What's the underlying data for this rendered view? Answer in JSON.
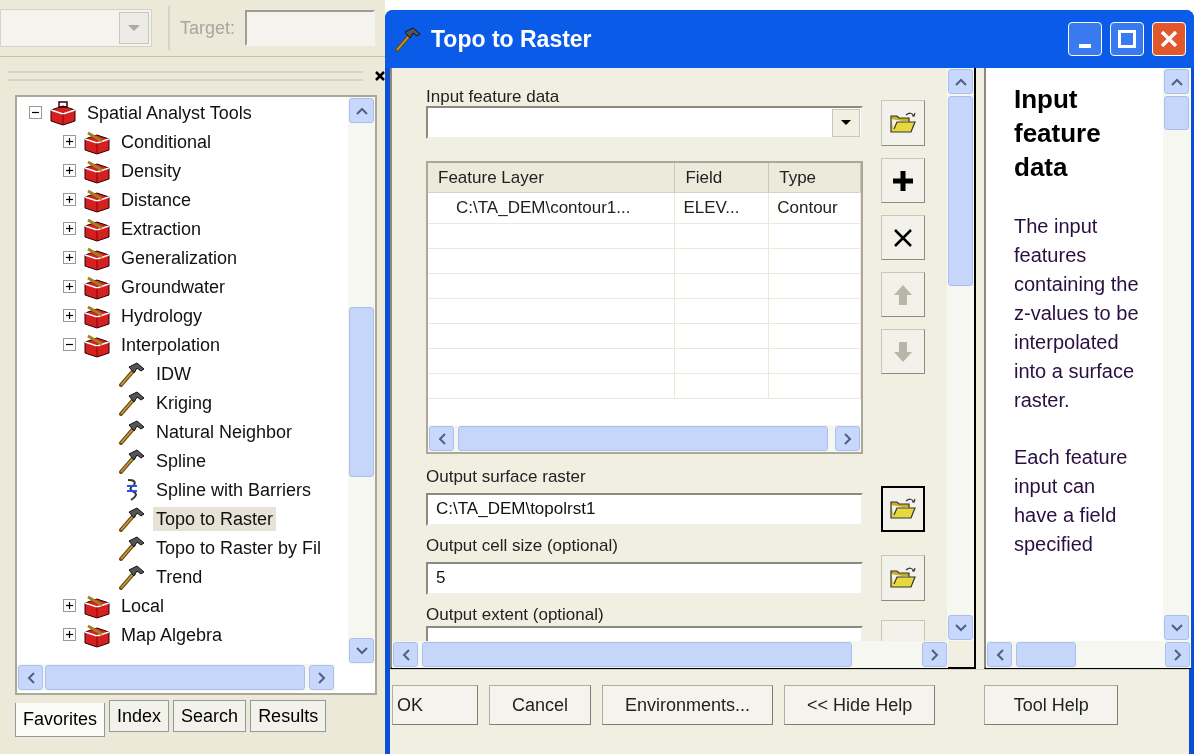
{
  "toolbar": {
    "target_label": "Target:"
  },
  "toolbox_tree": {
    "nodes": [
      {
        "label": "Spatial Analyst Tools",
        "kind": "toolbox",
        "expanded": true,
        "selected": false,
        "children": [
          {
            "label": "Conditional",
            "kind": "toolset",
            "expanded": false,
            "selected": false
          },
          {
            "label": "Density",
            "kind": "toolset",
            "expanded": false,
            "selected": false
          },
          {
            "label": "Distance",
            "kind": "toolset",
            "expanded": false,
            "selected": false
          },
          {
            "label": "Extraction",
            "kind": "toolset",
            "expanded": false,
            "selected": false
          },
          {
            "label": "Generalization",
            "kind": "toolset",
            "expanded": false,
            "selected": false
          },
          {
            "label": "Groundwater",
            "kind": "toolset",
            "expanded": false,
            "selected": false
          },
          {
            "label": "Hydrology",
            "kind": "toolset",
            "expanded": false,
            "selected": false
          },
          {
            "label": "Interpolation",
            "kind": "toolset",
            "expanded": true,
            "selected": false,
            "children": [
              {
                "label": "IDW",
                "kind": "tool",
                "selected": false
              },
              {
                "label": "Kriging",
                "kind": "tool",
                "selected": false
              },
              {
                "label": "Natural Neighbor",
                "kind": "tool",
                "selected": false
              },
              {
                "label": "Spline",
                "kind": "tool",
                "selected": false
              },
              {
                "label": "Spline with Barriers",
                "kind": "script",
                "selected": false
              },
              {
                "label": "Topo to Raster",
                "kind": "tool",
                "selected": true
              },
              {
                "label": "Topo to Raster by Fil",
                "kind": "tool",
                "selected": false
              },
              {
                "label": "Trend",
                "kind": "tool",
                "selected": false
              }
            ]
          },
          {
            "label": "Local",
            "kind": "toolset",
            "expanded": false,
            "selected": false
          },
          {
            "label": "Map Algebra",
            "kind": "toolset",
            "expanded": false,
            "selected": false
          }
        ]
      }
    ]
  },
  "panel_tabs": [
    {
      "label": "Favorites",
      "selected": true
    },
    {
      "label": "Index",
      "selected": false
    },
    {
      "label": "Search",
      "selected": false
    },
    {
      "label": "Results",
      "selected": false
    }
  ],
  "dialog": {
    "title": "Topo to Raster",
    "form": {
      "input_feature_data": {
        "label": "Input feature data"
      },
      "table": {
        "columns": [
          "Feature Layer",
          "Field",
          "Type"
        ],
        "rows": [
          [
            "C:\\TA_DEM\\contour1...",
            "ELEV...",
            "Contour"
          ]
        ]
      },
      "side_buttons": [
        {
          "kind": "add",
          "disabled": false
        },
        {
          "kind": "remove",
          "disabled": false
        },
        {
          "kind": "up",
          "disabled": true
        },
        {
          "kind": "down",
          "disabled": true
        }
      ],
      "fields": [
        {
          "kind": "text",
          "label": "Output surface raster",
          "value": "C:\\TA_DEM\\topolrst1",
          "focused": true
        },
        {
          "kind": "text",
          "label": "Output cell size (optional)",
          "value": "5",
          "focused": false
        },
        {
          "kind": "partial",
          "label": "Output extent (optional)"
        }
      ]
    },
    "help": {
      "heading": "Input feature data",
      "paragraphs": [
        "The input features containing the z-values to be interpolated into a surface raster.",
        "Each feature input can have a field specified"
      ]
    },
    "buttons": [
      "OK",
      "Cancel",
      "Environments...",
      "<< Hide Help"
    ],
    "help_button": "Tool Help"
  }
}
